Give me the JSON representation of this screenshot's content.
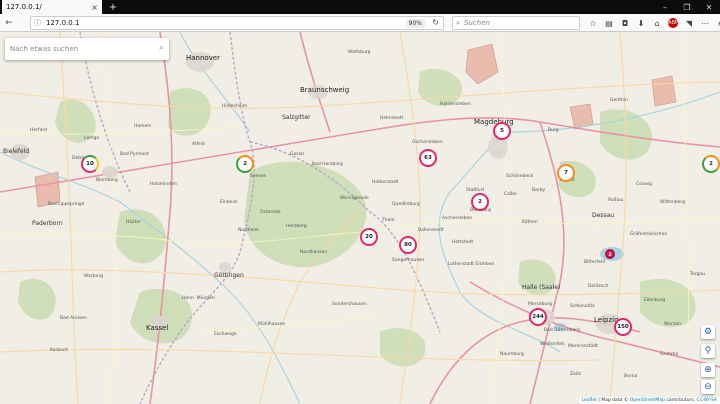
{
  "browser": {
    "tab_title": "127.0.0.1/",
    "tab_close": "×",
    "new_tab": "+",
    "url": "127.0.0.1",
    "zoom": "90%",
    "search_placeholder": "Suchen",
    "window_minimize": "–",
    "window_restore": "❐",
    "window_close": "✕"
  },
  "map": {
    "search_placeholder": "Nach etwas suchen",
    "clusters": [
      {
        "count": "10",
        "style": "mixed"
      },
      {
        "count": "2",
        "style": "green"
      },
      {
        "count": "63",
        "style": "pink"
      },
      {
        "count": "5",
        "style": "pink"
      },
      {
        "count": "7",
        "style": "orange"
      },
      {
        "count": "2",
        "style": "green"
      },
      {
        "count": "2",
        "style": "pink"
      },
      {
        "count": "20",
        "style": "pink"
      },
      {
        "count": "80",
        "style": "pink"
      },
      {
        "count": "244",
        "style": "pink"
      },
      {
        "count": "150",
        "style": "pink"
      },
      {
        "count": "2",
        "style": "red"
      }
    ],
    "places": {
      "hannover": "Hannover",
      "braunschweig": "Braunschweig",
      "magdeburg": "Magdeburg",
      "salzgitter": "Salzgitter",
      "bielefeld": "Bielefeld",
      "paderborn": "Paderborn",
      "halle": "Halle (Saale)",
      "leipzig": "Leipzig",
      "goettingen": "Göttingen",
      "kassel": "Kassel",
      "dessau": "Dessau",
      "bad_lippspringe": "Bad Lippspringe",
      "hildesheim": "Hildesheim",
      "goslar": "Goslar",
      "wolfsburg": "Wolfsburg",
      "halberstadt": "Halberstadt",
      "quedlinburg": "Quedlinburg",
      "wernigerode": "Wernigerode",
      "nordhausen": "Nordhausen",
      "sangerhausen": "Sangerhausen",
      "eisleben": "Lutherstadt Eisleben",
      "bernburg": "Bernburg",
      "koethen": "Köthen",
      "merseburg": "Merseburg",
      "naumburg": "Naumburg",
      "muehlhausen": "Mühlhausen",
      "eschwege": "Eschwege",
      "einbeck": "Einbeck",
      "holzminden": "Holzminden",
      "hameln": "Hameln",
      "detmold": "Detmold",
      "herford": "Herford",
      "oschersleben": "Oschersleben",
      "aschersleben": "Aschersleben",
      "schoenebeck": "Schönebeck",
      "zerbst": "Zerbst",
      "wittenberg": "Wittenberg",
      "bitterfeld": "Bitterfeld",
      "delitzsch": "Delitzsch",
      "eilenburg": "Eilenburg",
      "torgau": "Torgau",
      "burg": "Burg",
      "genthin": "Genthin",
      "hitzacker": "Haldensleben",
      "helmstedt": "Helmstedt",
      "northeim": "Northeim",
      "osterode": "Osterode",
      "herzberg": "Herzberg",
      "weissenfels": "Weißenfels",
      "zeitz": "Zeitz",
      "sondershausen": "Sondershausen",
      "hann_muenden": "Hann. Münden",
      "warburg": "Warburg",
      "hoexter": "Höxter",
      "bad_arolsen": "Bad Arolsen",
      "korbach": "Korbach",
      "lemgo": "Lemgo",
      "blomberg": "Blomberg",
      "bad_pyrmont": "Bad Pyrmont",
      "alfeld": "Alfeld",
      "seesen": "Seesen",
      "bad_harzburg": "Bad Harzburg",
      "thale": "Thale",
      "ballenstedt": "Ballenstedt",
      "hettstedt": "Hettstedt",
      "staßfurt": "Staßfurt",
      "calbe": "Calbe",
      "barby": "Barby",
      "rosslau": "Roßlau",
      "coswig": "Coswig",
      "gräfenhainichen": "Gräfenhainichen",
      "bad_duerrenberg": "Bad Dürrenberg",
      "markranstaedt": "Markranstädt",
      "schkeuditz": "Schkeuditz",
      "wurzen": "Wurzen",
      "grimma": "Grimma",
      "borna": "Borna"
    }
  },
  "controls": {
    "settings_icon": "gear-icon",
    "locate_icon": "pin-icon",
    "zoom_in_icon": "zoom-in-icon",
    "zoom_out_icon": "zoom-out-icon"
  },
  "attribution": {
    "leaflet": "Leaflet",
    "text": " | Map data © ",
    "osm": "OpenStreetMap",
    "contributors": " contributors, ",
    "license": "CC-BY-SA"
  },
  "colors": {
    "cluster_pink": "#e0286a",
    "cluster_orange": "#f08c1e",
    "cluster_green": "#3ca03c",
    "forest": "#c8dcb0",
    "land": "#f1eee6",
    "water": "#aad3df"
  }
}
